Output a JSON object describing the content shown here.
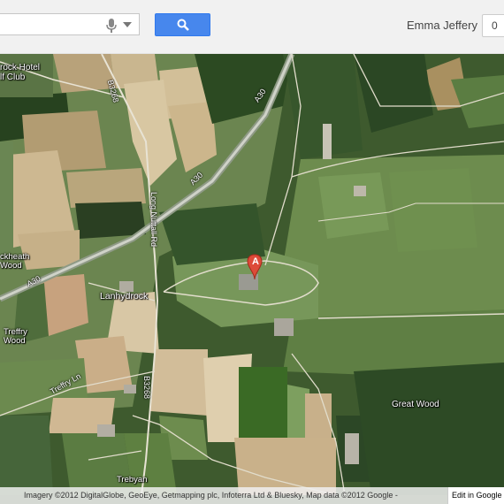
{
  "header": {
    "search_value": "",
    "user_name": "Emma Jeffery",
    "notification_count": "0",
    "search_button_icon": "search-icon",
    "mic_icon": "microphone-icon",
    "dropdown_icon": "chevron-down-icon"
  },
  "map": {
    "marker_letter": "A",
    "places": {
      "hotel": "rock Hotel",
      "golf": "lf Club",
      "lanhydrock": "Lanhydrock",
      "treffry": "Treffry",
      "treffry_wood": "Wood",
      "ckheath": "ckheath",
      "bodmin_wood": "Wood",
      "great_wood": "Great Wood",
      "trebyan": "Trebyan"
    },
    "roads": {
      "b3268_top": "B3268",
      "a30_upper": "A30",
      "a30_mid": "A30",
      "a30_left": "A30",
      "long_nuttall": "Long Nuttall Rd",
      "treffry_ln": "Treffry Ln",
      "b3268_bottom": "B3268"
    },
    "colors": {
      "marker": "#dd4b39",
      "field_light": "#c8b48f",
      "field_green": "#6a8a4a",
      "forest": "#2f4a24"
    }
  },
  "footer": {
    "attribution": "Imagery ©2012 DigitalGlobe, GeoEye, Getmapping plc, Infoterra Ltd & Bluesky, Map data ©2012 Google -",
    "edit_link": "Edit in Google"
  }
}
